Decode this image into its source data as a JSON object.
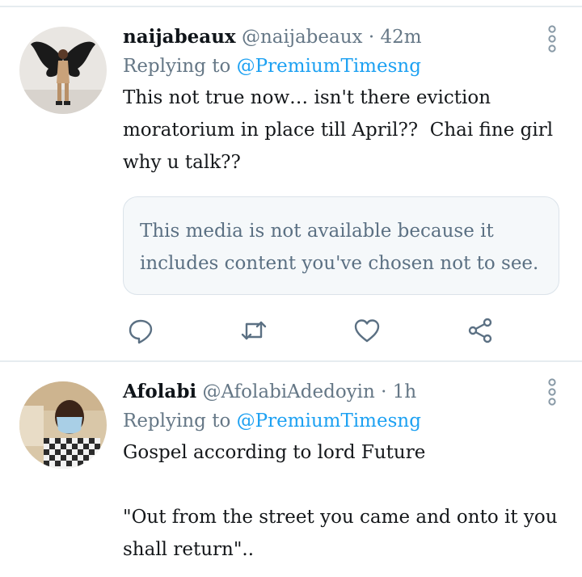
{
  "tweets": [
    {
      "display_name": "naijabeaux",
      "handle": "@naijabeaux",
      "separator": "·",
      "time": "42m",
      "replying_prefix": "Replying to",
      "replying_to": "@PremiumTimesng",
      "text": "This not true now… isn't there eviction moratorium in place till April??  Chai fine girl why u talk??",
      "media_notice": "This media is not available because it includes content you've chosen not to see.",
      "actions": [
        "reply-icon",
        "retweet-icon",
        "like-icon",
        "share-icon"
      ]
    },
    {
      "display_name": "Afolabi",
      "handle": "@AfolabiAdedoyin",
      "separator": "·",
      "time": "1h",
      "replying_prefix": "Replying to",
      "replying_to": "@PremiumTimesng",
      "text": "Gospel according to lord Future\n\n\"Out from the street you came and onto it you shall return\".."
    }
  ],
  "colors": {
    "link": "#1da1f2",
    "secondary_text": "#657786",
    "icon": "#5b7083",
    "divider": "#e6ecf0"
  }
}
